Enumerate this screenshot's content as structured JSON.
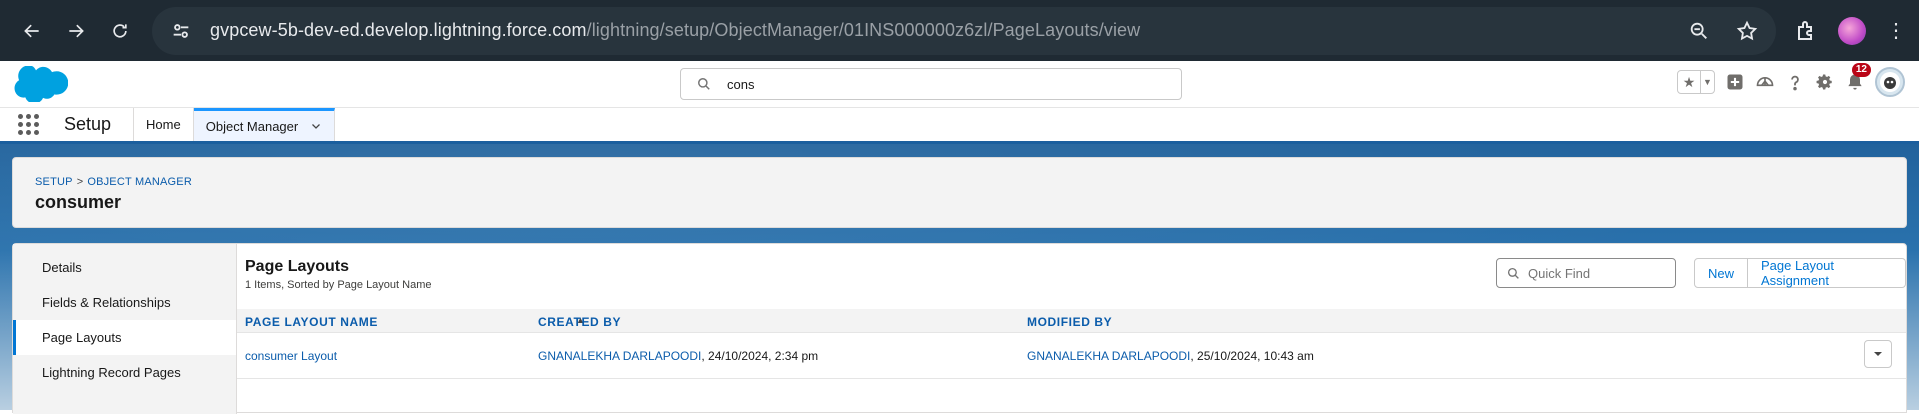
{
  "browser": {
    "url_host": "gvpcew-5b-dev-ed.develop.lightning.force.com",
    "url_path": "/lightning/setup/ObjectManager/01INS000000z6zl/PageLayouts/view"
  },
  "global_header": {
    "search_value": "cons",
    "notification_count": "12"
  },
  "app_nav": {
    "app_name": "Setup",
    "tabs": [
      {
        "label": "Home"
      },
      {
        "label": "Object Manager"
      }
    ]
  },
  "page_header": {
    "breadcrumb": [
      "SETUP",
      "OBJECT MANAGER"
    ],
    "breadcrumb_sep": ">",
    "title": "consumer"
  },
  "sidebar": {
    "items": [
      {
        "label": "Details"
      },
      {
        "label": "Fields & Relationships"
      },
      {
        "label": "Page Layouts"
      },
      {
        "label": "Lightning Record Pages"
      }
    ]
  },
  "content": {
    "title": "Page Layouts",
    "subtitle": "1 Items, Sorted by Page Layout Name",
    "quick_find_placeholder": "Quick Find",
    "buttons": {
      "new": "New",
      "assignment": "Page Layout Assignment"
    },
    "columns": [
      "PAGE LAYOUT NAME",
      "CREATED BY",
      "MODIFIED BY"
    ],
    "rows": [
      {
        "name": "consumer Layout",
        "created_by_user": "GNANALEKHA DARLAPOODI",
        "created_by_date": ", 24/10/2024, 2:34 pm",
        "modified_by_user": "GNANALEKHA DARLAPOODI",
        "modified_by_date": ", 25/10/2024, 10:43 am"
      }
    ]
  }
}
